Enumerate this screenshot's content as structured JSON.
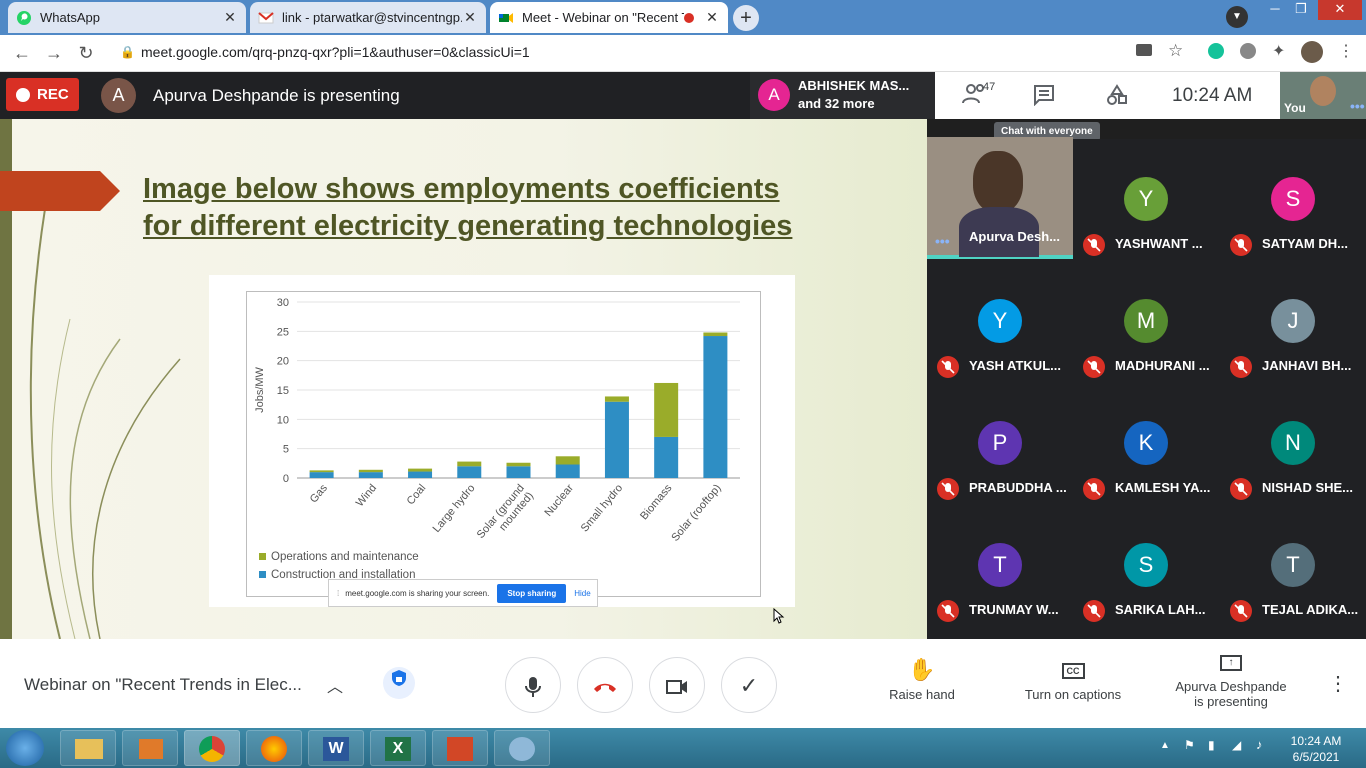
{
  "browser": {
    "tabs": [
      {
        "title": "WhatsApp",
        "icon": "whatsapp-icon"
      },
      {
        "title": "link - ptarwatkar@stvincentngp.e",
        "icon": "gmail-icon"
      },
      {
        "title": "Meet - Webinar on \"Recent T",
        "icon": "meet-icon",
        "active": true
      }
    ],
    "url": "meet.google.com/qrq-pnzq-qxr?pli=1&authuser=0&classicUi=1"
  },
  "meet_header": {
    "rec_label": "REC",
    "presenter_initial": "A",
    "presenting_text": "Apurva Deshpande is presenting",
    "speaker_initial": "A",
    "speaker_name": "ABHISHEK MAS...",
    "speaker_more": "and 32 more",
    "participant_count": "47",
    "time": "10:24 AM",
    "you_label": "You",
    "chat_tooltip": "Chat with everyone"
  },
  "slide": {
    "title_line1": "Image below shows employments coefficients",
    "title_line2": "for different electricity generating technologies",
    "share_notice": "meet.google.com is sharing your screen.",
    "stop_sharing": "Stop sharing",
    "hide": "Hide"
  },
  "chart_data": {
    "type": "bar",
    "stacked": true,
    "ylabel": "Jobs/MW",
    "ylim": [
      0,
      30
    ],
    "yticks": [
      0,
      5,
      10,
      15,
      20,
      25,
      30
    ],
    "categories": [
      "Gas",
      "Wind",
      "Coal",
      "Large hydro",
      "Solar (ground mounted)",
      "Nuclear",
      "Small hydro",
      "Biomass",
      "Solar (rooftop)"
    ],
    "series": [
      {
        "name": "Construction and installation",
        "color": "#2e8ec4",
        "values": [
          1.0,
          1.0,
          1.1,
          2.0,
          2.0,
          2.3,
          13.0,
          7.0,
          24.2
        ]
      },
      {
        "name": "Operations and maintenance",
        "color": "#9aac2a",
        "values": [
          0.3,
          0.4,
          0.5,
          0.8,
          0.6,
          1.4,
          0.9,
          9.2,
          0.6
        ]
      }
    ],
    "legend_position": "bottom-left",
    "grid": true
  },
  "participants": [
    {
      "name": "Apurva Desh...",
      "initial": "",
      "color": "#8a7a6a",
      "video": true
    },
    {
      "name": "YASHWANT ...",
      "initial": "Y",
      "color": "#689f38"
    },
    {
      "name": "SATYAM DH...",
      "initial": "S",
      "color": "#e52592"
    },
    {
      "name": "YASH ATKUL...",
      "initial": "Y",
      "color": "#039be5"
    },
    {
      "name": "MADHURANI ...",
      "initial": "M",
      "color": "#558b2f"
    },
    {
      "name": "JANHAVI BH...",
      "initial": "J",
      "color": "#78909c"
    },
    {
      "name": "PRABUDDHA ...",
      "initial": "P",
      "color": "#5e35b1"
    },
    {
      "name": "KAMLESH YA...",
      "initial": "K",
      "color": "#1565c0"
    },
    {
      "name": "NISHAD SHE...",
      "initial": "N",
      "color": "#00897b"
    },
    {
      "name": "TRUNMAY W...",
      "initial": "T",
      "color": "#5e35b1"
    },
    {
      "name": "SARIKA LAH...",
      "initial": "S",
      "color": "#0097a7"
    },
    {
      "name": "TEJAL ADIKA...",
      "initial": "T",
      "color": "#546e7a"
    }
  ],
  "bottom_bar": {
    "meeting_title": "Webinar on \"Recent Trends in Elec...",
    "raise_hand": "Raise hand",
    "captions": "Turn on captions",
    "presenting_line1": "Apurva Deshpande",
    "presenting_line2": "is presenting"
  },
  "taskbar": {
    "clock_time": "10:24 AM",
    "clock_date": "6/5/2021"
  }
}
